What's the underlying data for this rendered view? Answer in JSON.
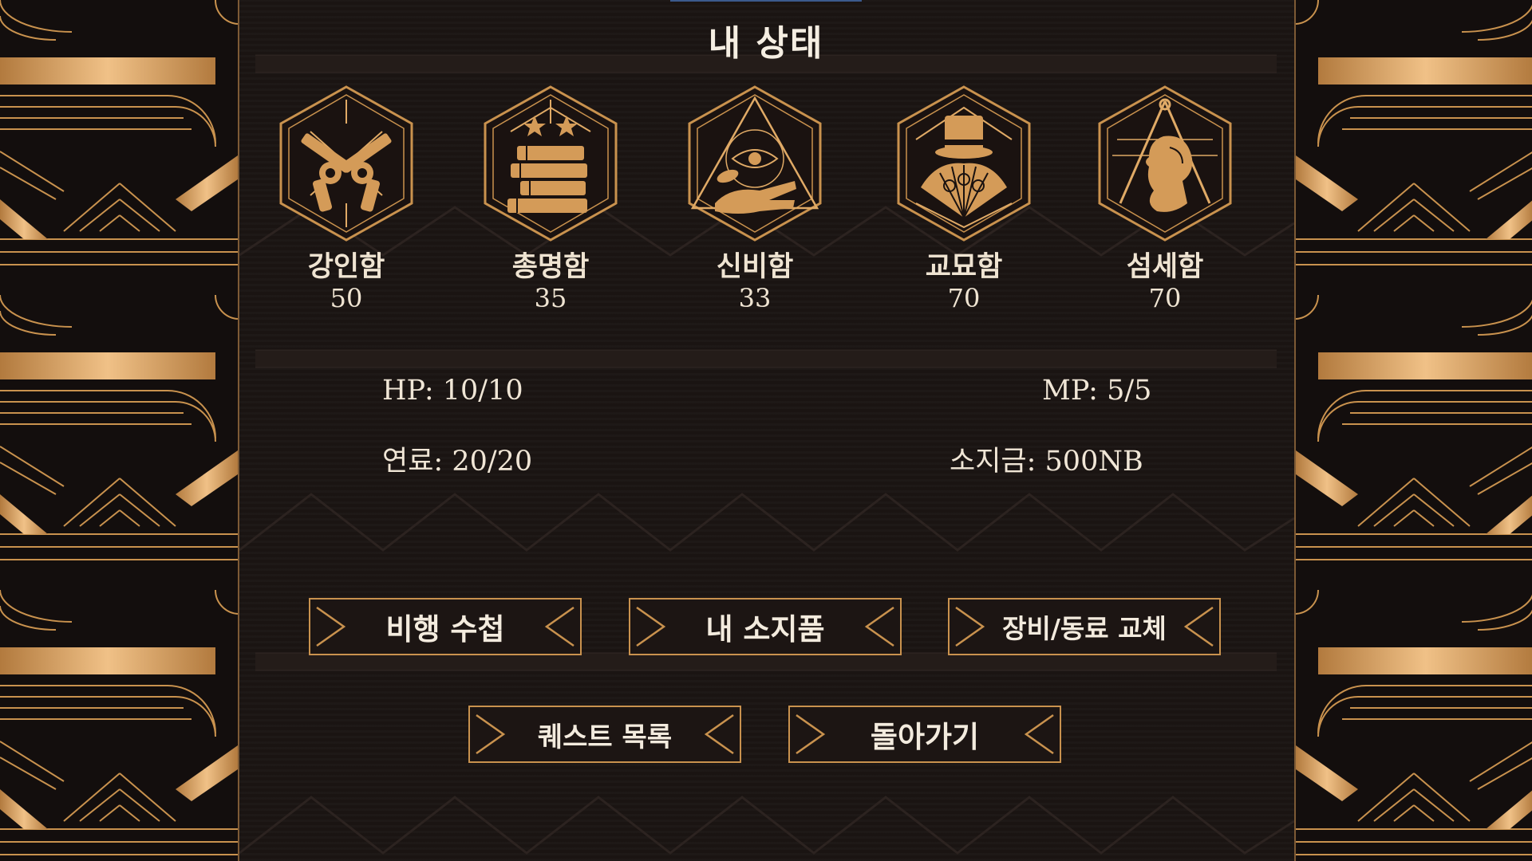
{
  "screen": {
    "title": "내 상태"
  },
  "stats": [
    {
      "icon": "crossed-revolvers-icon",
      "name": "강인함",
      "value": "50"
    },
    {
      "icon": "stacked-books-icon",
      "name": "총명함",
      "value": "35"
    },
    {
      "icon": "all-seeing-eye-hand-icon",
      "name": "신비함",
      "value": "33"
    },
    {
      "icon": "top-hat-fan-icon",
      "name": "교묘함",
      "value": "70"
    },
    {
      "icon": "compass-bust-icon",
      "name": "섬세함",
      "value": "70"
    }
  ],
  "status": {
    "hp_label": "HP: ",
    "hp_value": "10/10",
    "mp_label": "MP: ",
    "mp_value": "5/5",
    "fuel_label": "연료: ",
    "fuel_value": "20/20",
    "money_label": "소지금: ",
    "money_value": "500NB"
  },
  "buttons": {
    "flight_log": "비행 수첩",
    "inventory": "내 소지품",
    "equipment": "장비/동료 교체",
    "quests": "퀘스트 목록",
    "back": "돌아가기"
  },
  "colors": {
    "gold": "#c9924e",
    "gold_light": "#e7b978",
    "background": "#1a1412",
    "text": "#f1e9dc"
  }
}
